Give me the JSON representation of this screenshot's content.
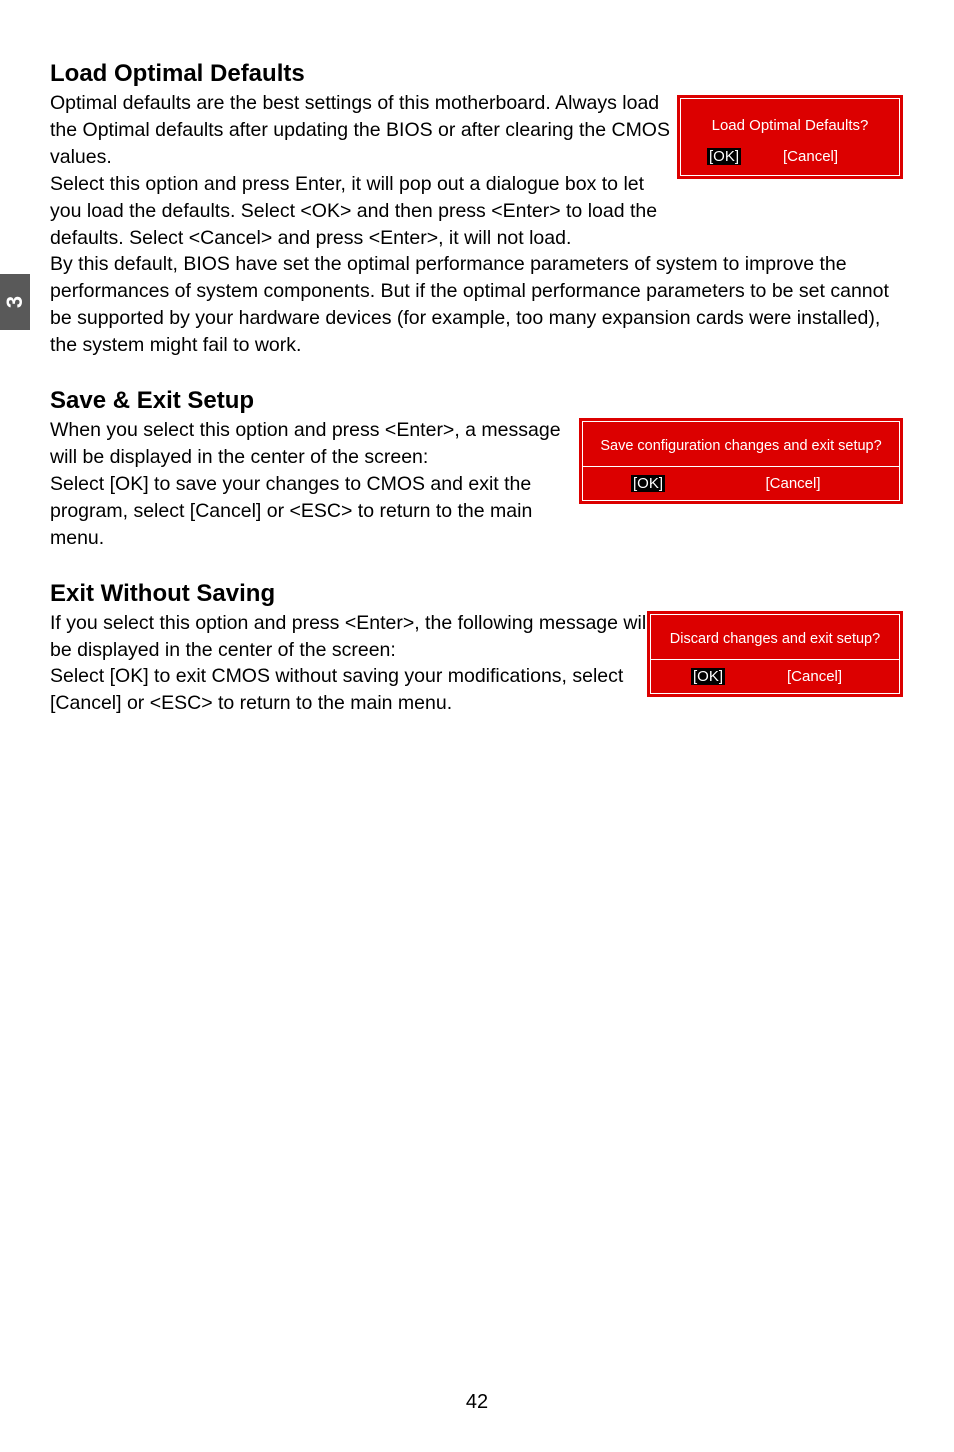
{
  "side_tab": "3",
  "section1": {
    "heading": "Load Optimal Defaults",
    "p1": "Optimal defaults are the best settings of this motherboard. Always load the Optimal defaults after updating the BIOS or after clearing the CMOS values.",
    "p2": "Select this option and press Enter, it will pop out a dialogue box to let you load the defaults. Select <OK> and then press <Enter> to load the defaults. Select <Cancel> and press <Enter>, it will not load.",
    "p3": "By this default, BIOS have set the optimal performance parameters of system to improve the performances of system components. But if the optimal performance parameters to be set cannot be supported by your hardware devices (for example, too many expansion cards were installed), the system might fail to work."
  },
  "section2": {
    "heading": "Save & Exit Setup",
    "p1": "When you select this option and press <Enter>, a message will be displayed in the center of the screen:",
    "p2": "Select [OK] to save your changes to CMOS and exit the program, select [Cancel] or <ESC> to return to the main menu."
  },
  "section3": {
    "heading": "Exit Without Saving",
    "p1": "If you select this option and press <Enter>, the following message will be displayed in the center of the screen:",
    "p2": "Select [OK] to exit CMOS without saving your modifications, select [Cancel] or <ESC> to return to the main menu."
  },
  "dialog1": {
    "message": "Load Optimal Defaults?",
    "ok": "[OK]",
    "cancel": "[Cancel]"
  },
  "dialog2": {
    "message": "Save configuration changes and exit setup?",
    "ok": "[OK]",
    "cancel": "[Cancel]"
  },
  "dialog3": {
    "message": "Discard changes and exit setup?",
    "ok": "[OK]",
    "cancel": "[Cancel]"
  },
  "page_number": "42"
}
